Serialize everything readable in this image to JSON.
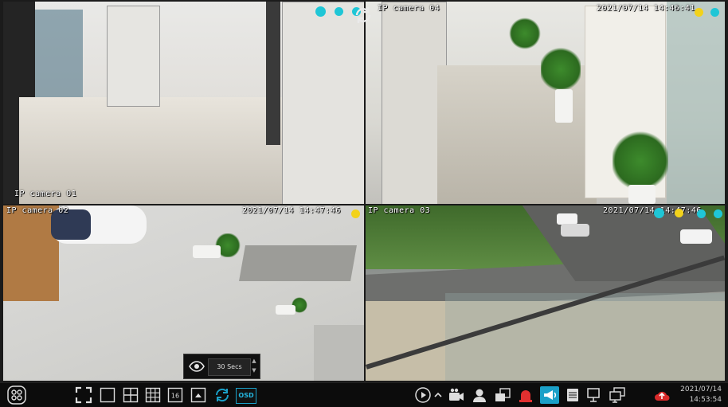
{
  "cameras": [
    {
      "label": "IP camera 01",
      "timestamp": ""
    },
    {
      "label": "IP camera 04",
      "timestamp": "2021/07/14 14:46:41"
    },
    {
      "label": "IP camera 02",
      "timestamp": "2021/07/14 14:47:46"
    },
    {
      "label": "IP camera 03",
      "timestamp": "2021/07/14 14:47:46"
    }
  ],
  "dwell": {
    "value": "30 Secs"
  },
  "toolbar": {
    "osd_label": "OSD"
  },
  "clock": {
    "date": "2021/07/14",
    "time": "14:53:54"
  },
  "colors": {
    "accent": "#1aa0c8",
    "indicator_cyan": "#1fc6d6",
    "indicator_yellow": "#f2d21b"
  }
}
